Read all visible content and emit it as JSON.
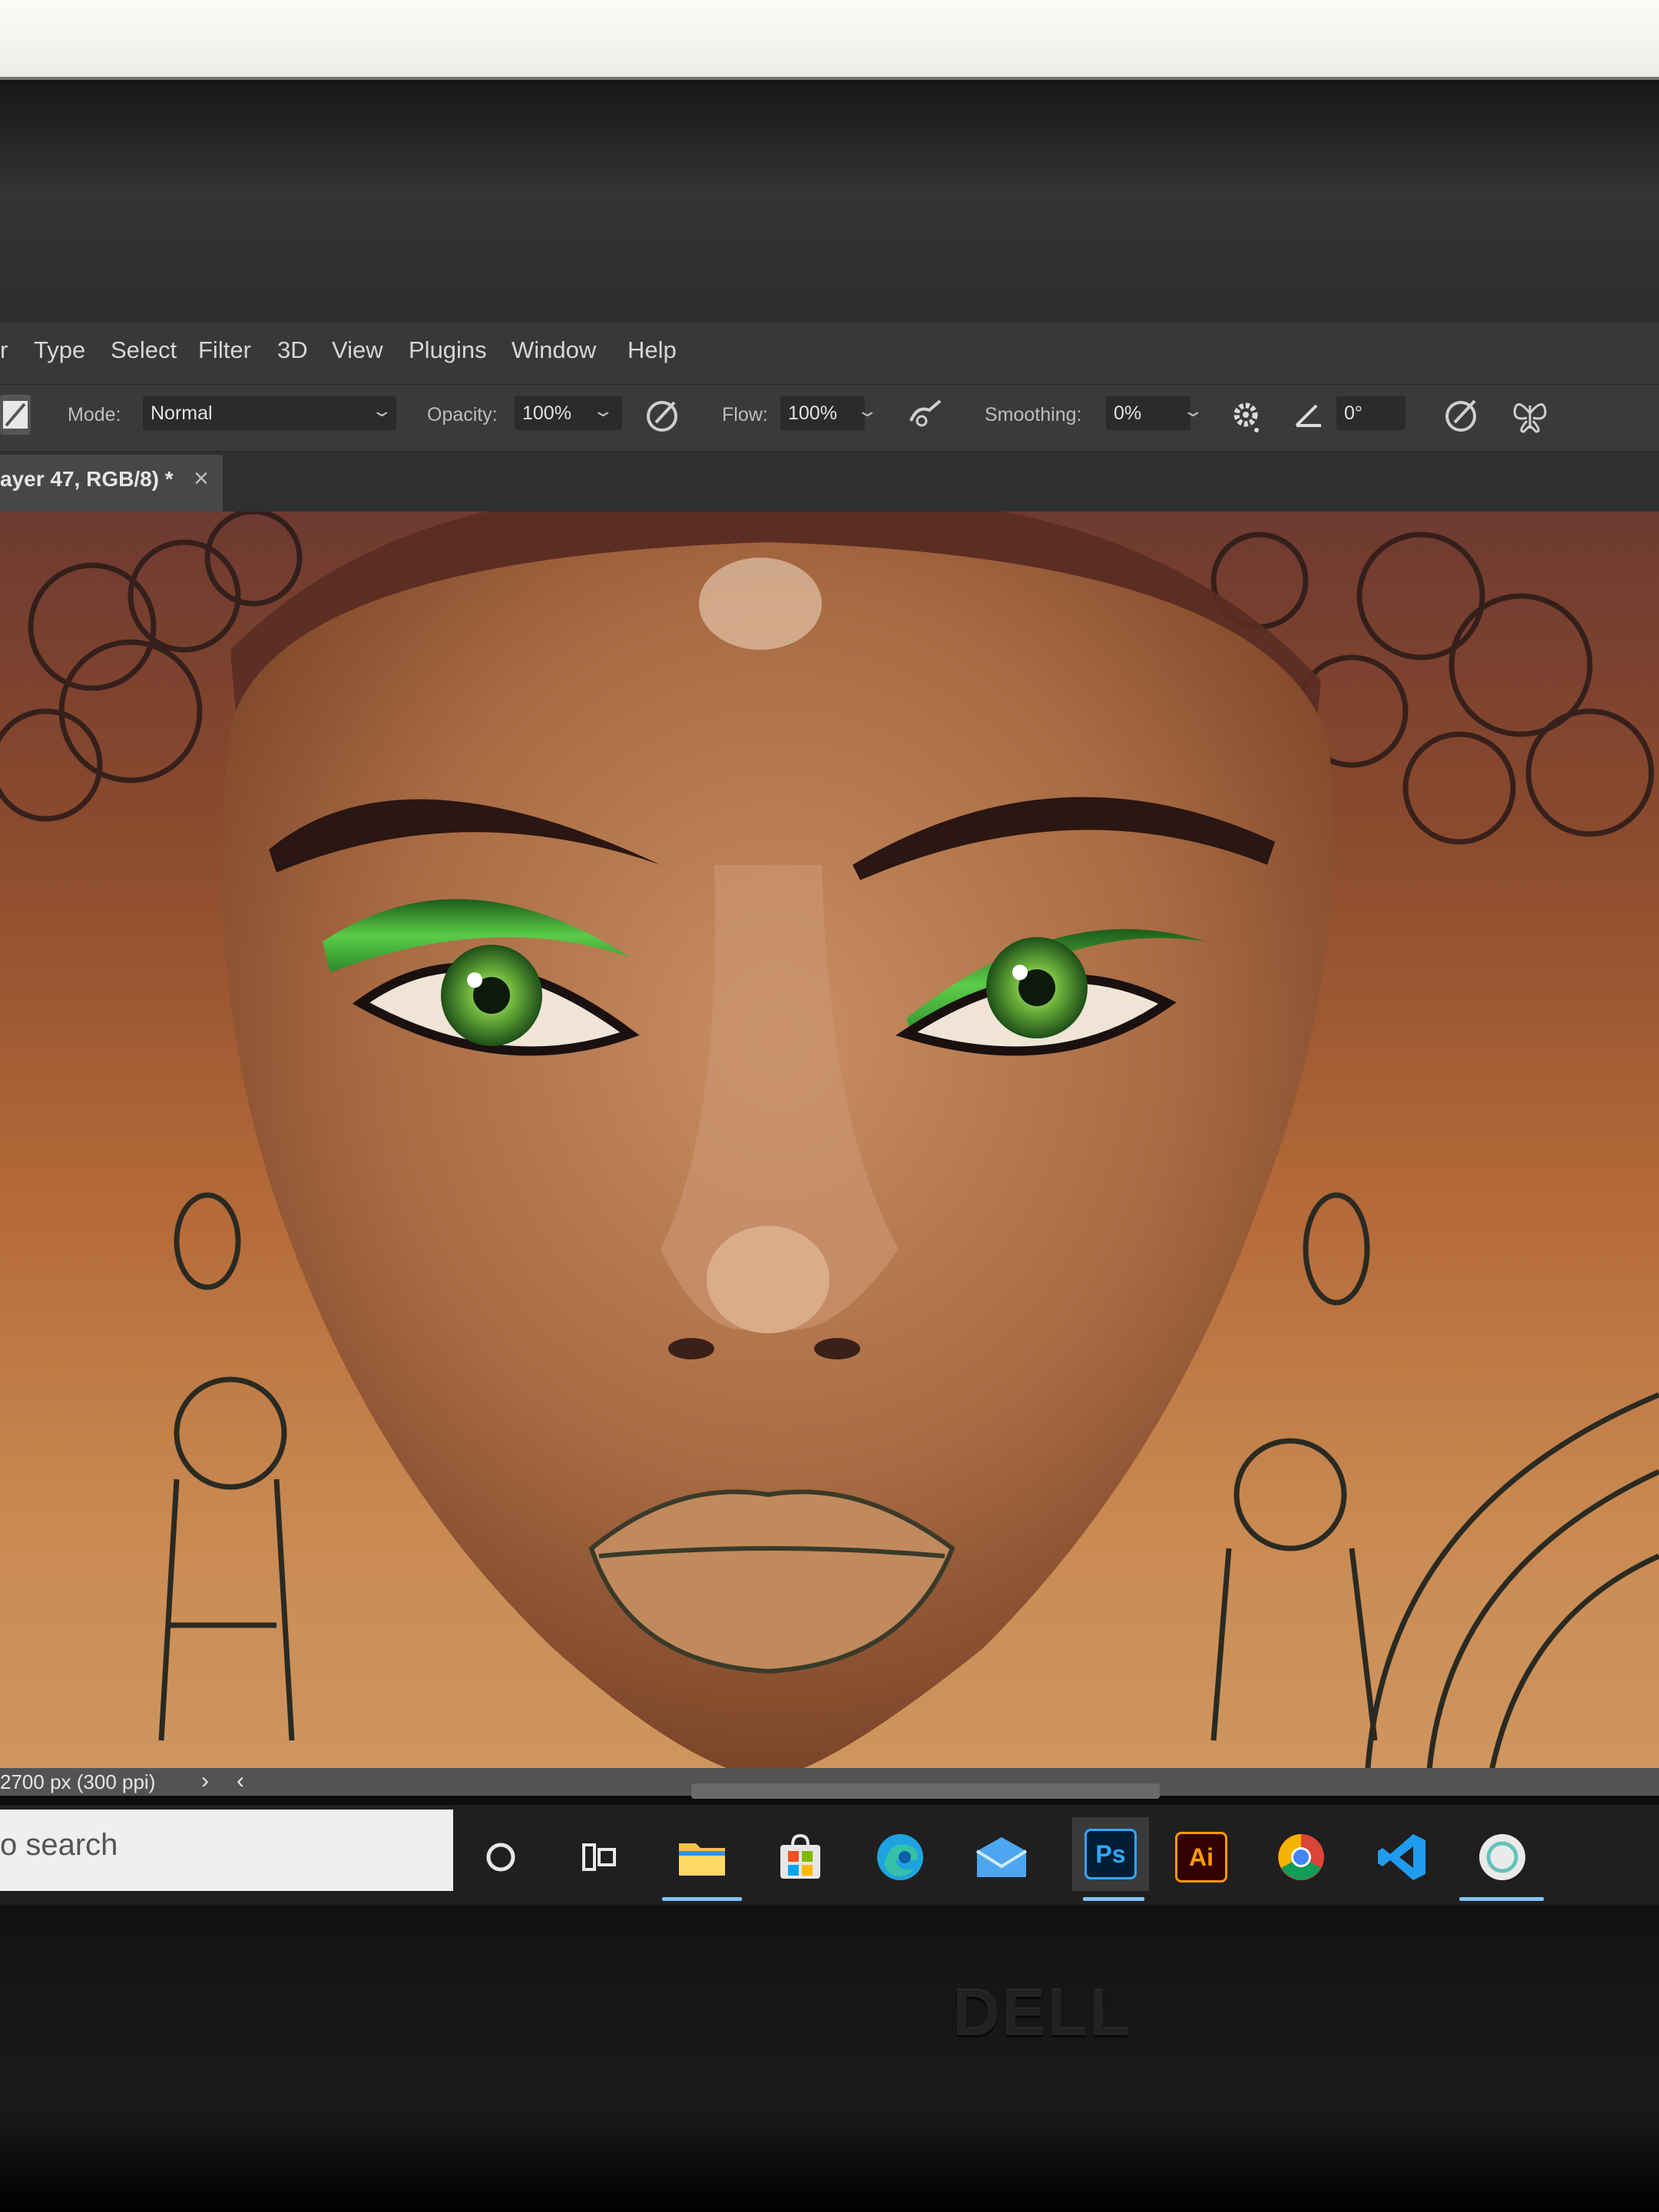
{
  "menu": {
    "items": [
      "r",
      "Type",
      "Select",
      "Filter",
      "3D",
      "View",
      "Plugins",
      "Window",
      "Help"
    ]
  },
  "options": {
    "mode_label": "Mode:",
    "mode_value": "Normal",
    "opacity_label": "Opacity:",
    "opacity_value": "100%",
    "flow_label": "Flow:",
    "flow_value": "100%",
    "smoothing_label": "Smoothing:",
    "smoothing_value": "0%",
    "angle_value": "0°"
  },
  "document": {
    "tab_title": "ayer 47, RGB/8) *",
    "close_glyph": "×"
  },
  "status": {
    "text": "2700 px (300 ppi)"
  },
  "taskbar": {
    "search_placeholder": "o search",
    "apps": [
      {
        "name": "Photoshop",
        "label": "Ps",
        "color": "#31a8ff"
      },
      {
        "name": "Illustrator",
        "label": "Ai",
        "color": "#ff9a00"
      }
    ]
  },
  "bezel": {
    "brand": "DELL"
  },
  "colors": {
    "accent": "#7ec3ff",
    "skin": "#b07a4e",
    "eyeshadow": "#3fae3a"
  }
}
